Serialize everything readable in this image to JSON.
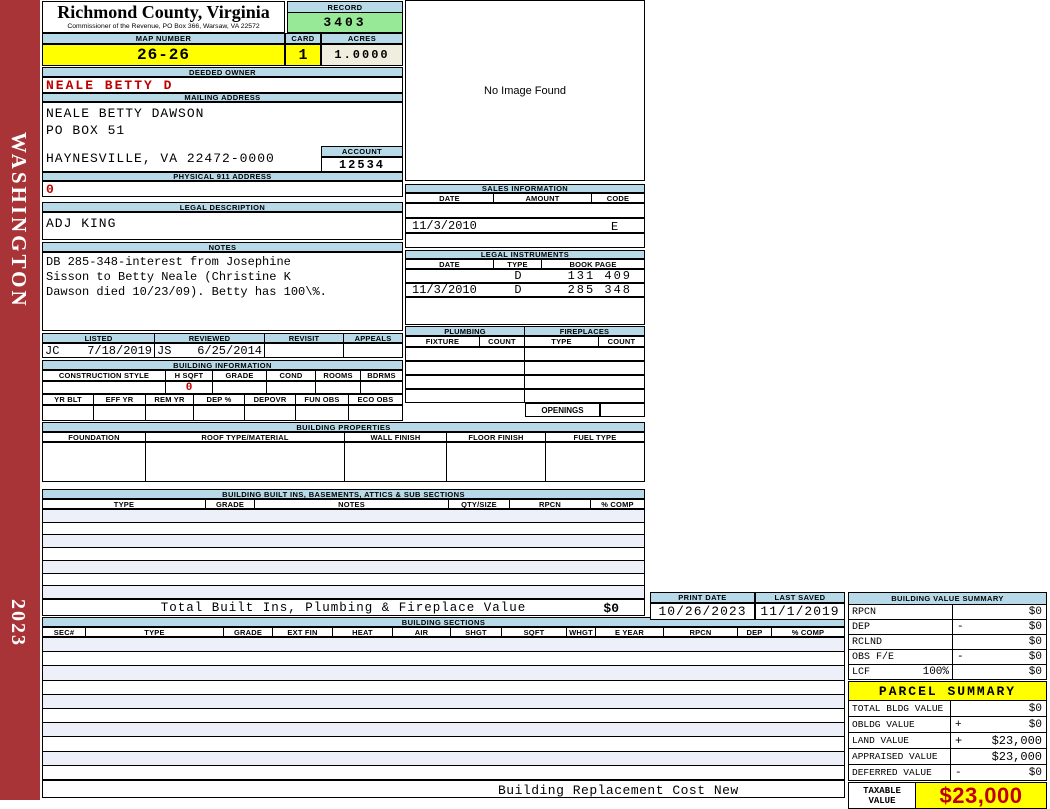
{
  "colors": {
    "sidebar_red": "#A93438",
    "header_blue": "#B8D9E8",
    "record_green": "#97E897",
    "highlight_yellow": "#FFFF00",
    "acres_cream": "#F0EFDF",
    "alert_red_text": "#C00000",
    "stripe_row": "#EEF0F9"
  },
  "sidebar": {
    "district": "WASHINGTON",
    "year": "2023"
  },
  "header": {
    "title": "Richmond County, Virginia",
    "subtitle": "Commissioner of the Revenue, PO Box 366, Warsaw, VA 22572",
    "record_label": "RECORD",
    "record_value": "3403",
    "map_number_label": "MAP NUMBER",
    "map_number": "26-26",
    "card_label": "CARD",
    "card": "1",
    "acres_label": "ACRES",
    "acres": "1.0000"
  },
  "owner": {
    "deeded_owner_label": "DEEDED OWNER",
    "deeded_owner": "NEALE BETTY D",
    "mailing_address_label": "MAILING ADDRESS",
    "mailing_lines": [
      "NEALE BETTY DAWSON",
      "PO BOX 51",
      "HAYNESVILLE, VA 22472-0000"
    ],
    "account_label": "ACCOUNT",
    "account": "12534",
    "physical_address_label": "PHYSICAL 911 ADDRESS",
    "physical_address": "0",
    "legal_description_label": "LEGAL DESCRIPTION",
    "legal_description": "ADJ KING",
    "notes_label": "NOTES",
    "notes_lines": [
      "DB 285-348-interest from Josephine",
      "Sisson to Betty Neale (Christine K",
      "Dawson died 10/23/09). Betty has 100\\%."
    ]
  },
  "review": {
    "headers": [
      "LISTED",
      "REVIEWED",
      "REVISIT",
      "APPEALS"
    ],
    "listed_by": "JC",
    "listed_date": "7/18/2019",
    "reviewed_by": "JS",
    "reviewed_date": "6/25/2014",
    "revisit": "",
    "appeals": ""
  },
  "building_information": {
    "title": "BUILDING INFORMATION",
    "headers_row1": [
      "CONSTRUCTION STYLE",
      "H SQFT",
      "GRADE",
      "COND",
      "ROOMS",
      "BDRMS"
    ],
    "h_sqft_value": "0",
    "headers_row2": [
      "YR BLT",
      "EFF YR",
      "REM YR",
      "DEP %",
      "DEPOVR",
      "FUN OBS",
      "ECO OBS"
    ]
  },
  "building_properties": {
    "title": "BUILDING PROPERTIES",
    "headers": [
      "FOUNDATION",
      "ROOF TYPE/MATERIAL",
      "WALL FINISH",
      "FLOOR FINISH",
      "FUEL TYPE"
    ]
  },
  "sales": {
    "title": "SALES INFORMATION",
    "headers": [
      "DATE",
      "AMOUNT",
      "CODE"
    ],
    "rows": [
      [
        "",
        "",
        ""
      ],
      [
        "11/3/2010",
        "",
        "E"
      ],
      [
        "",
        "",
        ""
      ]
    ]
  },
  "legal_instruments": {
    "title": "LEGAL INSTRUMENTS",
    "headers": [
      "DATE",
      "TYPE",
      "BOOK PAGE"
    ],
    "rows": [
      [
        "",
        "D",
        "131 409"
      ],
      [
        "11/3/2010",
        "D",
        "285 348"
      ]
    ]
  },
  "plumbing_fireplaces": {
    "plumbing_title": "PLUMBING",
    "fireplaces_title": "FIREPLACES",
    "headers": [
      "FIXTURE",
      "COUNT",
      "TYPE",
      "COUNT"
    ],
    "openings_label": "OPENINGS"
  },
  "built_ins": {
    "title": "BUILDING BUILT INS, BASEMENTS, ATTICS & SUB SECTIONS",
    "headers": [
      "TYPE",
      "GRADE",
      "NOTES",
      "QTY/SIZE",
      "RPCN",
      "% COMP"
    ],
    "total_label": "Total Built Ins, Plumbing & Fireplace Value",
    "total_value": "$0"
  },
  "image_panel": {
    "message": "No Image Found"
  },
  "print_info": {
    "print_date_label": "PRINT DATE",
    "print_date": "10/26/2023",
    "last_saved_label": "LAST SAVED",
    "last_saved": "11/1/2019"
  },
  "building_sections": {
    "title": "BUILDING SECTIONS",
    "headers": [
      "SEC#",
      "TYPE",
      "GRADE",
      "EXT FIN",
      "HEAT",
      "AIR",
      "SHGT",
      "SQFT",
      "WHGT",
      "E YEAR",
      "RPCN",
      "DEP",
      "% COMP"
    ],
    "footer": "Building Replacement Cost New"
  },
  "building_value_summary": {
    "title": "BUILDING VALUE SUMMARY",
    "rows": [
      {
        "label": "RPCN",
        "pct": "",
        "sign": "",
        "value": "$0"
      },
      {
        "label": "DEP",
        "pct": "",
        "sign": "-",
        "value": "$0"
      },
      {
        "label": "RCLND",
        "pct": "",
        "sign": "",
        "value": "$0"
      },
      {
        "label": "OBS F/E",
        "pct": "",
        "sign": "-",
        "value": "$0"
      },
      {
        "label": "LCF",
        "pct": "100%",
        "sign": "",
        "value": "$0"
      }
    ]
  },
  "parcel_summary": {
    "title": "PARCEL SUMMARY",
    "rows": [
      {
        "label": "TOTAL BLDG VALUE",
        "sign": "",
        "value": "$0"
      },
      {
        "label": "OBLDG VALUE",
        "sign": "+",
        "value": "$0"
      },
      {
        "label": "LAND VALUE",
        "sign": "+",
        "value": "$23,000"
      },
      {
        "label": "APPRAISED VALUE",
        "sign": "",
        "value": "$23,000"
      },
      {
        "label": "DEFERRED VALUE",
        "sign": "-",
        "value": "$0"
      }
    ],
    "taxable_label": "TAXABLE VALUE",
    "taxable_value": "$23,000"
  }
}
